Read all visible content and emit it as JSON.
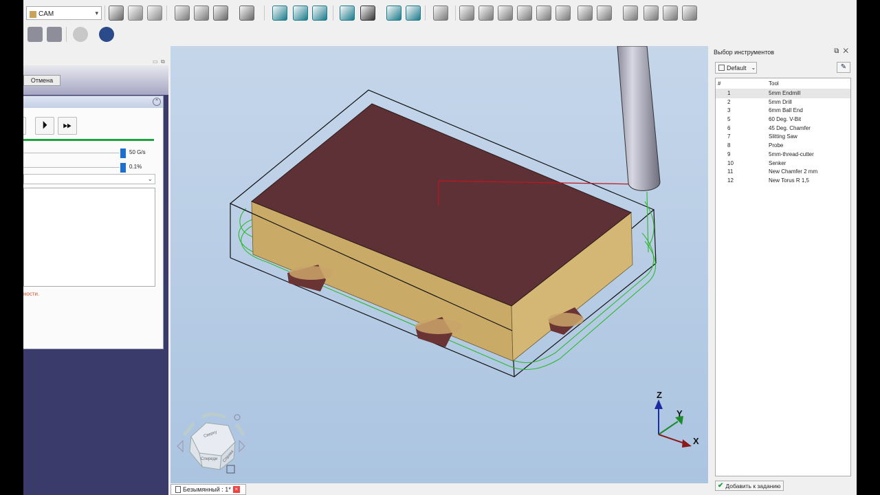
{
  "toolbar": {
    "workbench": "CAM",
    "icons_row1": [
      "cut-icon",
      "copy-icon",
      "paste-icon",
      "part-icon",
      "folder-icon",
      "export-icon",
      "macro-icon",
      "zoom-fit-icon",
      "zoom-selection-icon",
      "view-box-icon",
      "measure-icon",
      "draw-style-icon",
      "std-views-icon",
      "zoom-icon",
      "sketch-icon",
      "profile-icon",
      "pocket-icon",
      "adaptive-icon",
      "face-icon",
      "helix-icon",
      "engrave-icon",
      "vcarve-icon",
      "chamfer-icon",
      "deburr-icon",
      "surface-icon",
      "waterline-icon",
      "probe-icon"
    ],
    "icons_row2": [
      "simulator-icon",
      "inspect-icon",
      "info-icon",
      "tool-bit-icon"
    ]
  },
  "task_panel": {
    "cancel_label": "Отмена",
    "speed_value": "50 G/s",
    "accuracy_value": "0.1%",
    "warning_text": "ности."
  },
  "viewport": {
    "axis_x": "X",
    "axis_y": "Y",
    "axis_z": "Z",
    "navcube_faces": [
      "Сверху",
      "Спереди",
      "Справа"
    ]
  },
  "doc_tab": {
    "label": "Безымянный : 1*"
  },
  "tool_panel": {
    "title": "Выбор инструментов",
    "library": "Default",
    "columns": [
      "#",
      "Tool"
    ],
    "tools": [
      {
        "num": "1",
        "name": "5mm Endmill"
      },
      {
        "num": "2",
        "name": "5mm Drill"
      },
      {
        "num": "3",
        "name": "6mm Ball End"
      },
      {
        "num": "5",
        "name": "60 Deg. V-Bit"
      },
      {
        "num": "6",
        "name": "45 Deg. Chamfer"
      },
      {
        "num": "7",
        "name": "Slitting Saw"
      },
      {
        "num": "8",
        "name": "Probe"
      },
      {
        "num": "9",
        "name": "5mm-thread-cutter"
      },
      {
        "num": "10",
        "name": "Senker"
      },
      {
        "num": "11",
        "name": "New Chamfer 2 mm"
      },
      {
        "num": "12",
        "name": "New Torus R 1,5"
      }
    ],
    "add_label": "Добавить к заданию"
  }
}
